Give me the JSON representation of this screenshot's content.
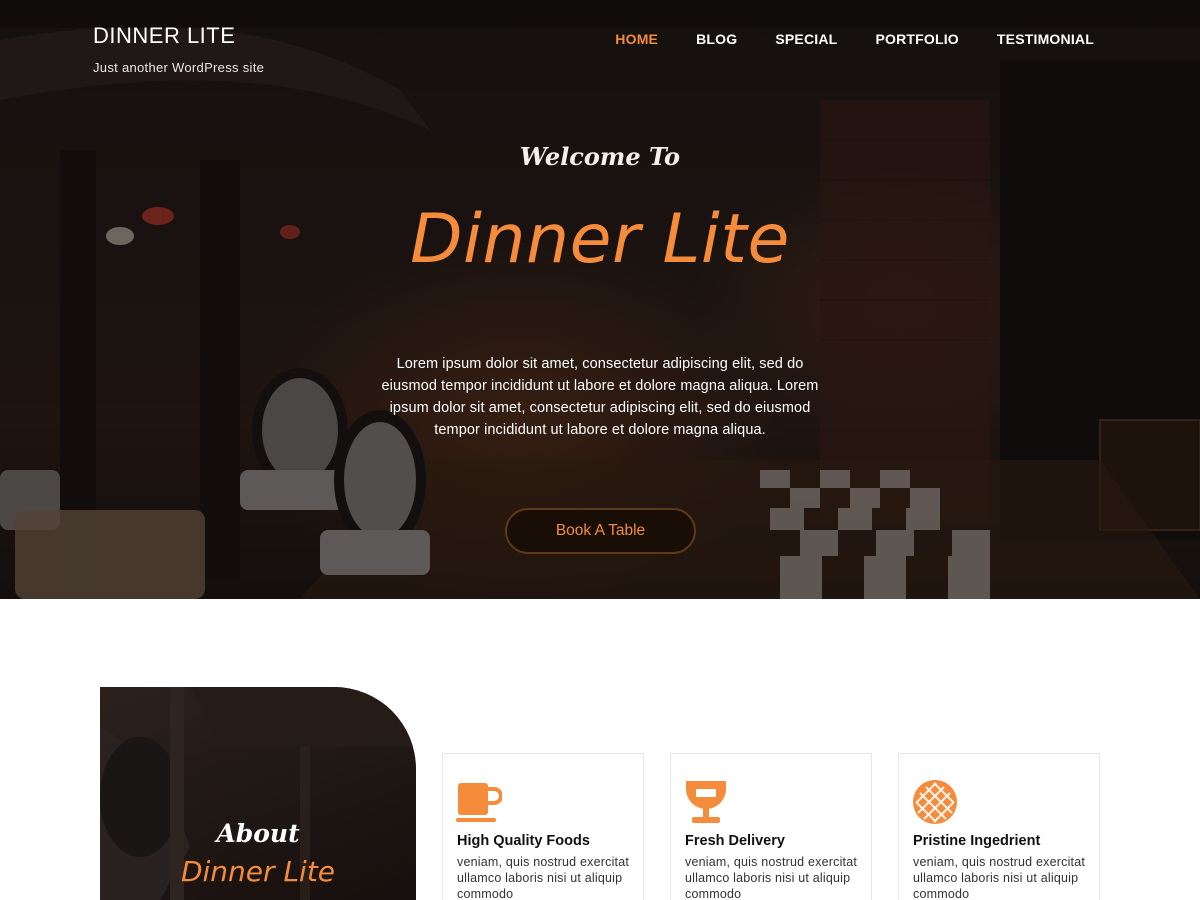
{
  "site": {
    "title": "DINNER LITE",
    "tagline": "Just another WordPress site"
  },
  "nav": {
    "items": [
      {
        "label": "HOME",
        "active": true
      },
      {
        "label": "BLOG",
        "active": false
      },
      {
        "label": "SPECIAL",
        "active": false
      },
      {
        "label": "PORTFOLIO",
        "active": false
      },
      {
        "label": "TESTIMONIAL",
        "active": false
      }
    ]
  },
  "hero": {
    "welcome": "Welcome To",
    "title": "Dinner Lite",
    "text_line1": "Lorem ipsum dolor sit amet, consectetur adipiscing elit, sed do eiusmod tempor incididunt ut labore et dolore magna aliqua.",
    "text_line2": "Lorem ipsum dolor sit amet, consectetur adipiscing elit, sed do eiusmod tempor incididunt ut labore et dolore magna aliqua.",
    "button_label": "Book A Table"
  },
  "about": {
    "title_line1": "About",
    "title_line2": "Dinner Lite"
  },
  "features": [
    {
      "icon": "coffee-cup-icon",
      "title": "High Quality Foods",
      "text": "veniam, quis nostrud exercitat ullamco laboris nisi ut aliquip commodo"
    },
    {
      "icon": "wine-glass-icon",
      "title": "Fresh Delivery",
      "text": "veniam, quis nostrud exercitat ullamco laboris nisi ut aliquip commodo"
    },
    {
      "icon": "pie-icon",
      "title": "Pristine Ingedrient",
      "text": "veniam, quis nostrud exercitat ullamco laboris nisi ut aliquip commodo"
    }
  ],
  "colors": {
    "accent": "#f48c3c",
    "hero_dark": "#1c1613",
    "button_bg": "#180e06",
    "button_border": "#5d3916"
  }
}
